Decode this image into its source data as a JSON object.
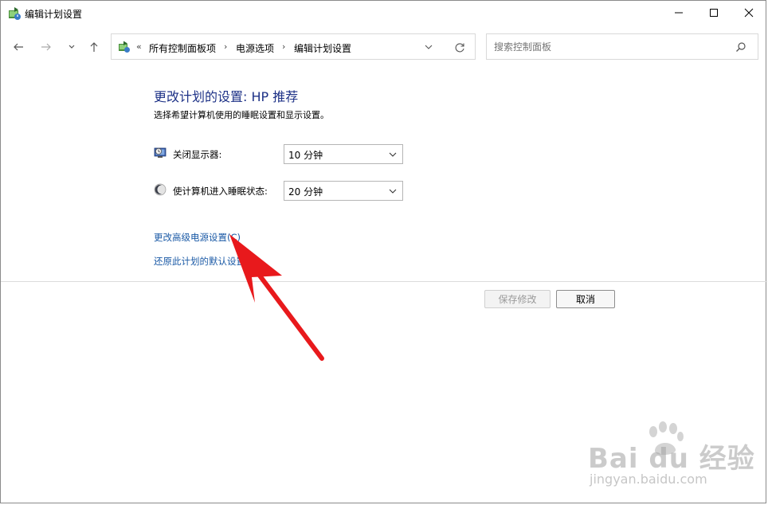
{
  "window": {
    "title": "编辑计划设置"
  },
  "address": {
    "prefix": "«",
    "segments": [
      "所有控制面板项",
      "电源选项",
      "编辑计划设置"
    ],
    "separator": "›"
  },
  "search": {
    "placeholder": "搜索控制面板"
  },
  "content": {
    "title": "更改计划的设置: HP 推荐",
    "subtitle": "选择希望计算机使用的睡眠设置和显示设置。",
    "settings": [
      {
        "label": "关闭显示器:",
        "value": "10 分钟",
        "icon": "display-icon"
      },
      {
        "label": "使计算机进入睡眠状态:",
        "value": "20 分钟",
        "icon": "moon-icon"
      }
    ],
    "links": {
      "advanced": "更改高级电源设置(C)",
      "restore": "还原此计划的默认设置(R)"
    }
  },
  "buttons": {
    "save": "保存修改",
    "cancel": "取消"
  },
  "watermark": {
    "main": "Bai du 经验",
    "url": "jingyan.baidu.com"
  },
  "colors": {
    "title_blue": "#1e3287",
    "link_blue": "#1b5aa6",
    "arrow_red": "#e8191c"
  }
}
